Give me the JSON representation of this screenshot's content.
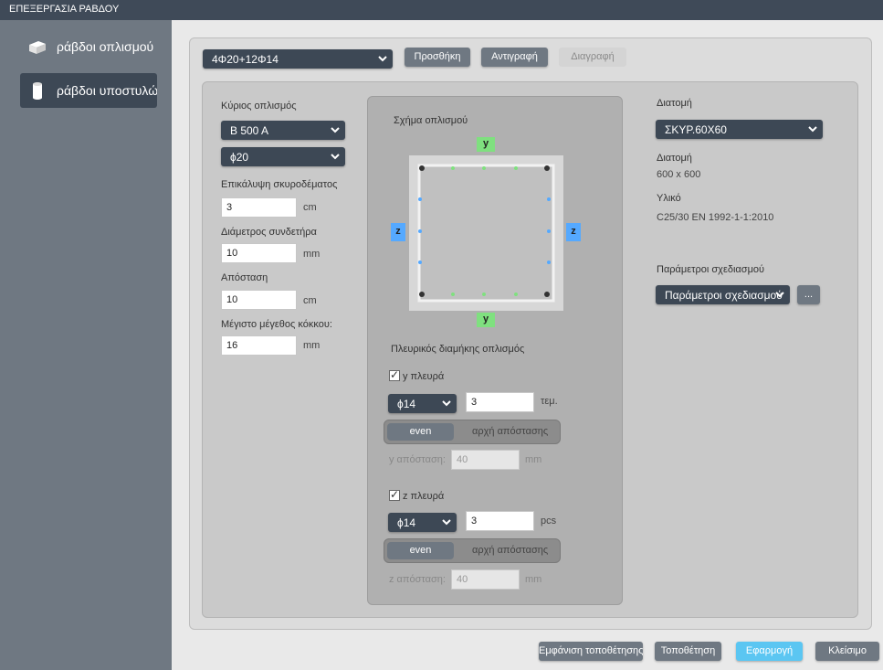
{
  "window": {
    "title": "ΕΠΕΞΕΡΓΑΣΙΑ ΡΑΒΔΟΥ"
  },
  "sidebar": {
    "items": [
      {
        "label": "ράβδοι οπλισμού",
        "icon": "box-icon"
      },
      {
        "label": "ράβδοι υποστυλώμ",
        "icon": "cylinder-icon"
      }
    ]
  },
  "top": {
    "rebar_set": "4Φ20+12Φ14",
    "add_label": "Προσθήκη",
    "copy_label": "Αντιγραφή",
    "delete_label": "Διαγραφή"
  },
  "left": {
    "main_rebar_label": "Κύριος οπλισμός",
    "steel_grade": "B 500 A",
    "main_diameter": "ϕ20",
    "cover_label": "Επικάλυψη σκυροδέματος",
    "cover_value": "3",
    "cover_unit": "cm",
    "stirrup_diam_label": "Διάμετρος συνδετήρα",
    "stirrup_diam_value": "10",
    "stirrup_diam_unit": "mm",
    "spacing_label": "Απόσταση",
    "spacing_value": "10",
    "spacing_unit": "cm",
    "aggregate_label": "Μέγιστο μέγεθος κόκκου:",
    "aggregate_value": "16",
    "aggregate_unit": "mm"
  },
  "center": {
    "shape_label": "Σχήμα οπλισμού",
    "tag_y": "y",
    "tag_z": "z",
    "side_label": "Πλευρικός διαμήκης οπλισμός",
    "y_side": {
      "label": "y πλευρά",
      "checked": true,
      "diameter": "ϕ14",
      "count": "3",
      "count_unit": "τεμ.",
      "mode_on": "even",
      "mode_off": "αρχή απόστασης",
      "spacing_label": "y απόσταση:",
      "spacing_value": "40",
      "spacing_unit": "mm"
    },
    "z_side": {
      "label": "z πλευρά",
      "checked": true,
      "diameter": "ϕ14",
      "count": "3",
      "count_unit": "pcs",
      "mode_on": "even",
      "mode_off": "αρχή απόστασης",
      "spacing_label": "z απόσταση:",
      "spacing_value": "40",
      "spacing_unit": "mm"
    }
  },
  "right": {
    "section_label": "Διατομή",
    "section_select": "ΣΚΥΡ.60Χ60",
    "section_info_label": "Διατομή",
    "section_info_value": "600 x 600",
    "material_label": "Υλικό",
    "material_value": "C25/30  EN 1992-1-1:2010",
    "design_params_label": "Παράμετροι σχεδιασμού",
    "design_params_select": "Παράμετροι σχεδιασμού",
    "more_button": "..."
  },
  "footer": {
    "show_placement": "Εμφάνιση τοποθέτησης",
    "placement": "Τοποθέτηση",
    "apply": "Εφαρμογή",
    "close": "Κλείσιμο"
  },
  "colors": {
    "dark": "#3d4855",
    "button": "#6f7882",
    "primary": "#5bc6f2",
    "y_tag": "#7fe07f",
    "z_tag": "#55a9ff"
  }
}
